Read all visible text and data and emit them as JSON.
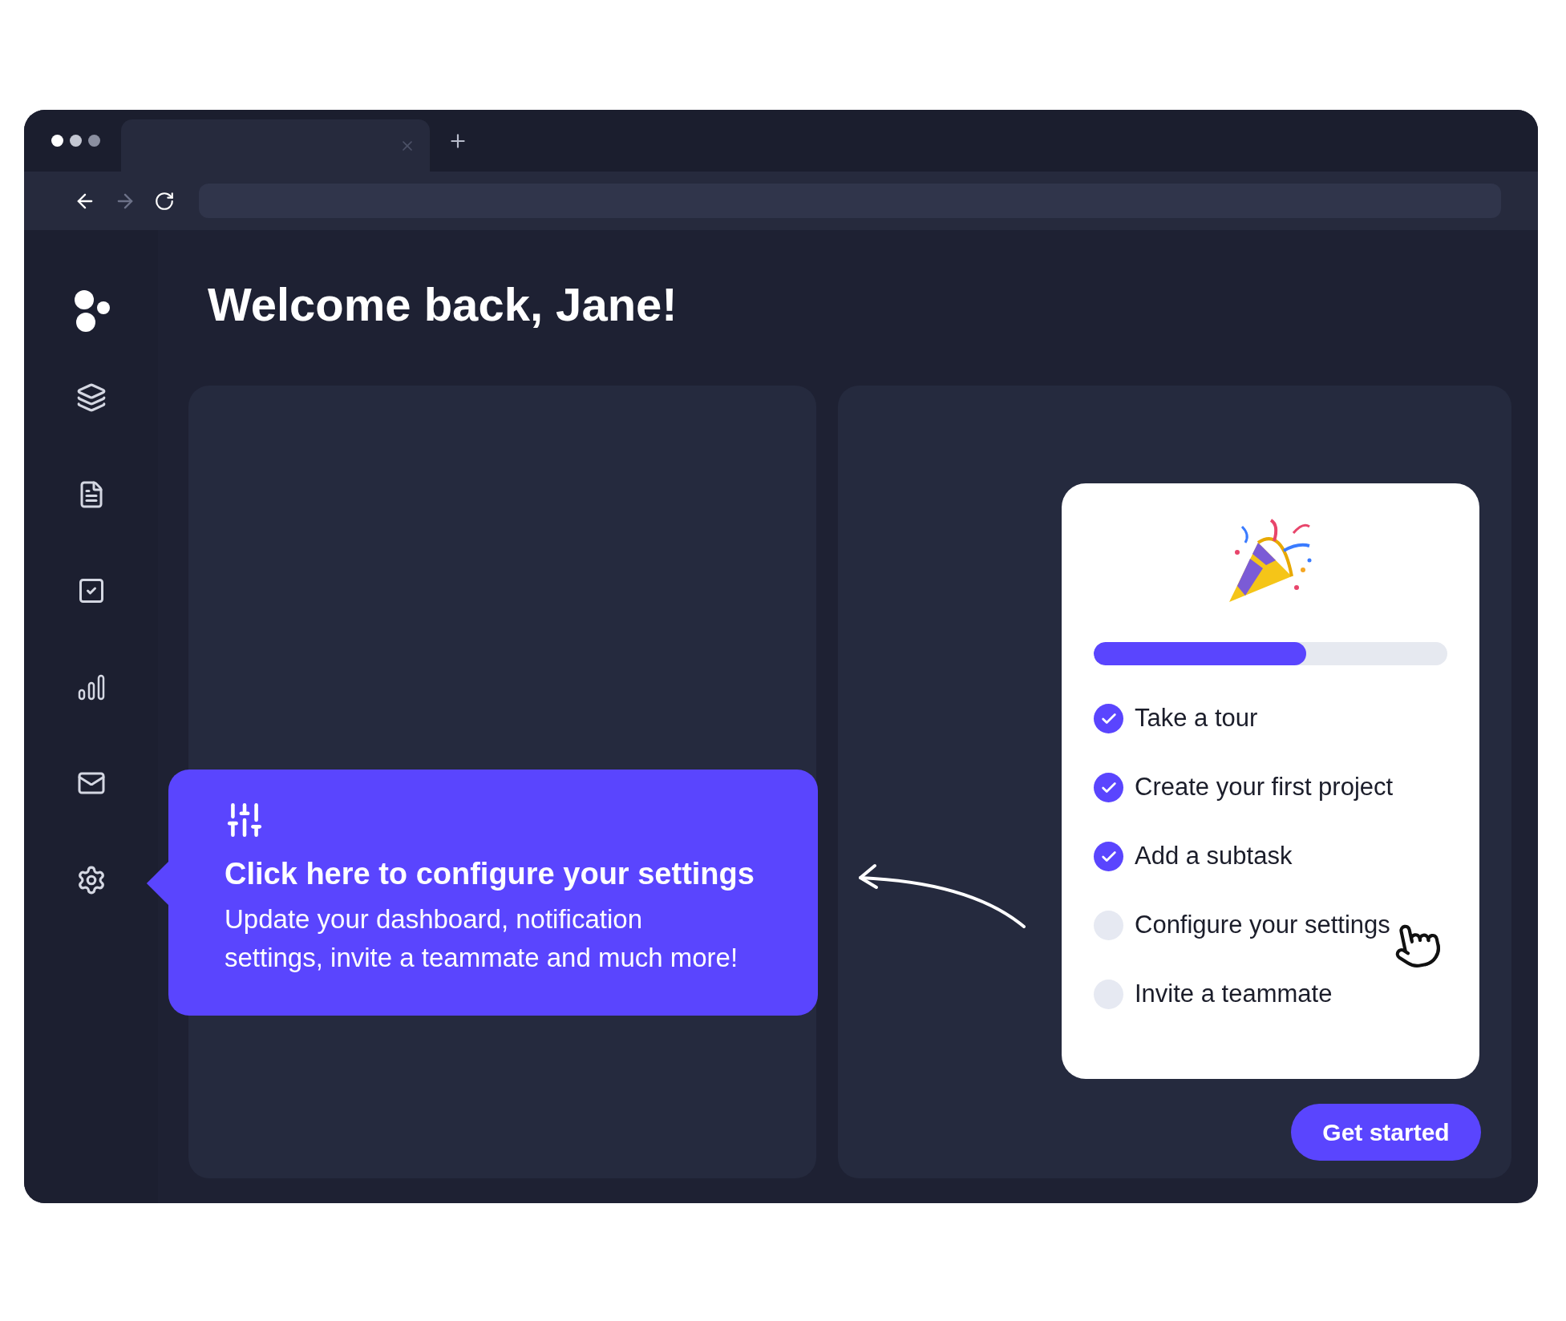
{
  "browser": {
    "forward": {
      "disabled": true
    }
  },
  "heading": "Welcome back, Jane!",
  "tooltip": {
    "title": "Click here to configure your settings",
    "body": "Update your dashboard, notification settings, invite a teammate and much more!"
  },
  "checklist": {
    "level": 0.6,
    "items": [
      {
        "label": "Take a tour",
        "checked": true
      },
      {
        "label": "Create your first project",
        "checked": true
      },
      {
        "label": "Add a subtask",
        "checked": true
      },
      {
        "label": "Configure your settings",
        "checked": false
      },
      {
        "label": "Invite a teammate",
        "checked": false
      }
    ]
  },
  "button": "Get started"
}
